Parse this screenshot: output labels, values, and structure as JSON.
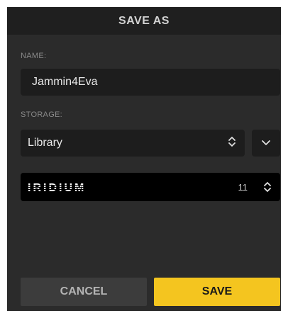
{
  "dialog": {
    "title": "SAVE AS"
  },
  "name_field": {
    "label": "NAME:",
    "value": "Jammin4Eva"
  },
  "storage": {
    "label": "STORAGE:",
    "selected": "Library"
  },
  "device": {
    "logo_text": "IRIDIUM",
    "count": "11"
  },
  "buttons": {
    "cancel": "CANCEL",
    "save": "SAVE"
  },
  "colors": {
    "dialog_bg": "#2b2b2b",
    "titlebar_bg": "#1f1f1f",
    "field_bg": "#1d1d1d",
    "device_bg": "#000000",
    "cancel_bg": "#3c3c3c",
    "save_accent": "#f4c51f"
  },
  "icons": {
    "storage_stepper": "up-down-chevron-icon",
    "storage_dropdown": "chevron-down-icon",
    "device_stepper": "up-down-chevron-icon"
  }
}
